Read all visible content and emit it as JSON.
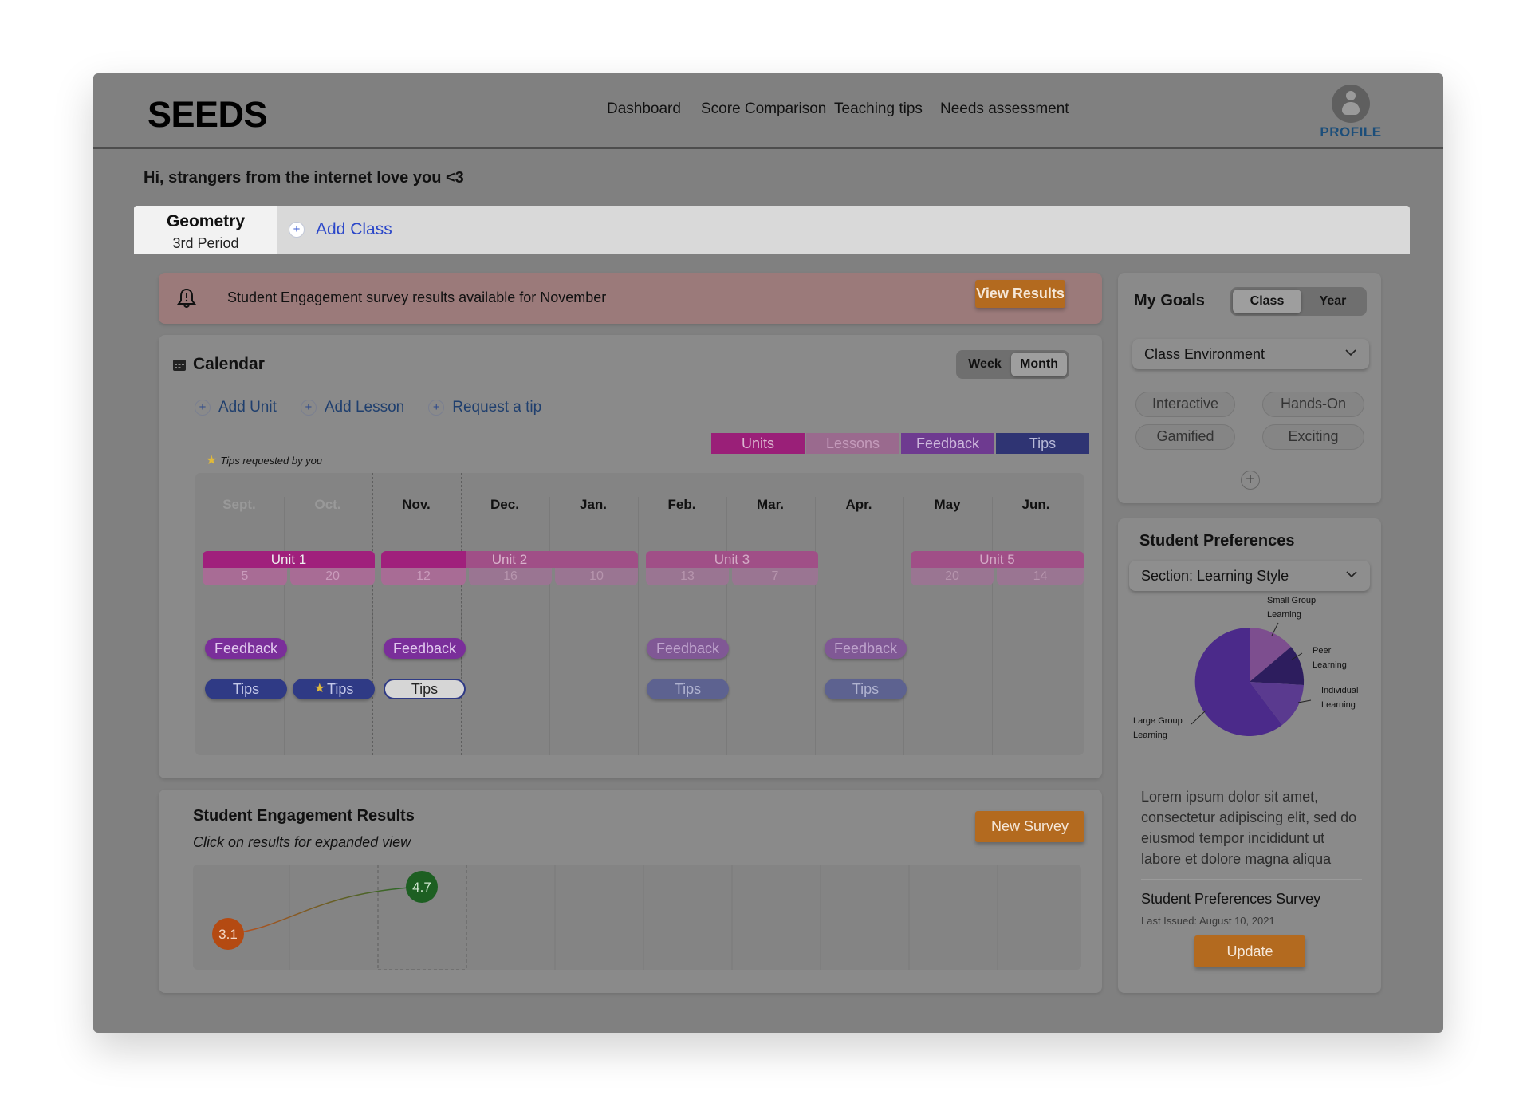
{
  "header": {
    "logo": "SEEDS",
    "nav": [
      "Dashboard",
      "Score Comparison",
      "Teaching tips",
      "Needs assessment"
    ],
    "profile_label": "PROFILE"
  },
  "greeting": "Hi, strangers from the internet love you <3",
  "classes": {
    "active_name": "Geometry",
    "active_period": "3rd Period",
    "add_label": "Add Class"
  },
  "alert": {
    "message": "Student Engagement survey results available for November",
    "button": "View Results"
  },
  "calendar": {
    "title": "Calendar",
    "view_toggle": [
      "Week",
      "Month"
    ],
    "active_view": "Month",
    "actions": [
      "Add Unit",
      "Add Lesson",
      "Request a tip"
    ],
    "legend": [
      {
        "label": "Units",
        "color": "#b0177f"
      },
      {
        "label": "Lessons",
        "color": "#a0608f"
      },
      {
        "label": "Feedback",
        "color": "#7b2aa3"
      },
      {
        "label": "Tips",
        "color": "#2b2f7f"
      }
    ],
    "tips_note": "Tips requested by you",
    "months": [
      "Sept.",
      "Oct.",
      "Nov.",
      "Dec.",
      "Jan.",
      "Feb.",
      "Mar.",
      "Apr.",
      "May",
      "Jun."
    ],
    "current_month": "Nov.",
    "units": [
      {
        "label": "Unit 1",
        "lessons": [
          "5",
          "20"
        ]
      },
      {
        "label": "Unit 2",
        "lessons": [
          "12",
          "16",
          "10"
        ]
      },
      {
        "label": "Unit 3",
        "lessons": [
          "13",
          "7"
        ]
      },
      {
        "label": "Unit 5",
        "lessons": [
          "20",
          "14"
        ]
      }
    ],
    "feedback_label": "Feedback",
    "tips_label": "Tips"
  },
  "engagement": {
    "title": "Student Engagement Results",
    "subtitle": "Click on results for expanded view",
    "button": "New Survey",
    "scores": [
      "3.1",
      "4.7"
    ]
  },
  "goals": {
    "title": "My Goals",
    "toggle": [
      "Class",
      "Year"
    ],
    "active_toggle": "Class",
    "dropdown": "Class Environment",
    "chips": [
      "Interactive",
      "Hands-On",
      "Gamified",
      "Exciting"
    ]
  },
  "preferences": {
    "title": "Student Preferences",
    "dropdown": "Section: Learning Style",
    "pie_labels": {
      "small_group": [
        "Small Group",
        "Learning"
      ],
      "peer": [
        "Peer",
        "Learning"
      ],
      "individual": [
        "Individual",
        "Learning"
      ],
      "large_group": [
        "Large Group",
        "Learning"
      ]
    },
    "description": "Lorem ipsum dolor sit amet, consectetur adipiscing elit, sed do eiusmod tempor incididunt ut labore et dolore magna aliqua",
    "survey_title": "Student Preferences Survey",
    "survey_date": "Last Issued: August 10, 2021",
    "button": "Update"
  }
}
